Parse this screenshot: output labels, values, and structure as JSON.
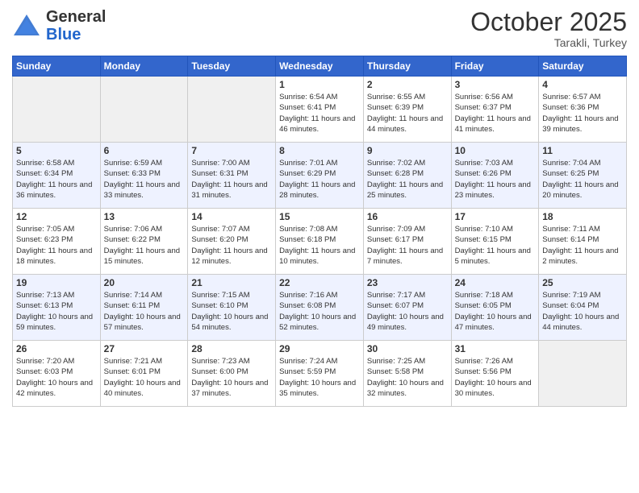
{
  "header": {
    "logo_general": "General",
    "logo_blue": "Blue",
    "month": "October 2025",
    "location": "Tarakli, Turkey"
  },
  "weekdays": [
    "Sunday",
    "Monday",
    "Tuesday",
    "Wednesday",
    "Thursday",
    "Friday",
    "Saturday"
  ],
  "weeks": [
    [
      {
        "day": "",
        "sunrise": "",
        "sunset": "",
        "daylight": ""
      },
      {
        "day": "",
        "sunrise": "",
        "sunset": "",
        "daylight": ""
      },
      {
        "day": "",
        "sunrise": "",
        "sunset": "",
        "daylight": ""
      },
      {
        "day": "1",
        "sunrise": "Sunrise: 6:54 AM",
        "sunset": "Sunset: 6:41 PM",
        "daylight": "Daylight: 11 hours and 46 minutes."
      },
      {
        "day": "2",
        "sunrise": "Sunrise: 6:55 AM",
        "sunset": "Sunset: 6:39 PM",
        "daylight": "Daylight: 11 hours and 44 minutes."
      },
      {
        "day": "3",
        "sunrise": "Sunrise: 6:56 AM",
        "sunset": "Sunset: 6:37 PM",
        "daylight": "Daylight: 11 hours and 41 minutes."
      },
      {
        "day": "4",
        "sunrise": "Sunrise: 6:57 AM",
        "sunset": "Sunset: 6:36 PM",
        "daylight": "Daylight: 11 hours and 39 minutes."
      }
    ],
    [
      {
        "day": "5",
        "sunrise": "Sunrise: 6:58 AM",
        "sunset": "Sunset: 6:34 PM",
        "daylight": "Daylight: 11 hours and 36 minutes."
      },
      {
        "day": "6",
        "sunrise": "Sunrise: 6:59 AM",
        "sunset": "Sunset: 6:33 PM",
        "daylight": "Daylight: 11 hours and 33 minutes."
      },
      {
        "day": "7",
        "sunrise": "Sunrise: 7:00 AM",
        "sunset": "Sunset: 6:31 PM",
        "daylight": "Daylight: 11 hours and 31 minutes."
      },
      {
        "day": "8",
        "sunrise": "Sunrise: 7:01 AM",
        "sunset": "Sunset: 6:29 PM",
        "daylight": "Daylight: 11 hours and 28 minutes."
      },
      {
        "day": "9",
        "sunrise": "Sunrise: 7:02 AM",
        "sunset": "Sunset: 6:28 PM",
        "daylight": "Daylight: 11 hours and 25 minutes."
      },
      {
        "day": "10",
        "sunrise": "Sunrise: 7:03 AM",
        "sunset": "Sunset: 6:26 PM",
        "daylight": "Daylight: 11 hours and 23 minutes."
      },
      {
        "day": "11",
        "sunrise": "Sunrise: 7:04 AM",
        "sunset": "Sunset: 6:25 PM",
        "daylight": "Daylight: 11 hours and 20 minutes."
      }
    ],
    [
      {
        "day": "12",
        "sunrise": "Sunrise: 7:05 AM",
        "sunset": "Sunset: 6:23 PM",
        "daylight": "Daylight: 11 hours and 18 minutes."
      },
      {
        "day": "13",
        "sunrise": "Sunrise: 7:06 AM",
        "sunset": "Sunset: 6:22 PM",
        "daylight": "Daylight: 11 hours and 15 minutes."
      },
      {
        "day": "14",
        "sunrise": "Sunrise: 7:07 AM",
        "sunset": "Sunset: 6:20 PM",
        "daylight": "Daylight: 11 hours and 12 minutes."
      },
      {
        "day": "15",
        "sunrise": "Sunrise: 7:08 AM",
        "sunset": "Sunset: 6:18 PM",
        "daylight": "Daylight: 11 hours and 10 minutes."
      },
      {
        "day": "16",
        "sunrise": "Sunrise: 7:09 AM",
        "sunset": "Sunset: 6:17 PM",
        "daylight": "Daylight: 11 hours and 7 minutes."
      },
      {
        "day": "17",
        "sunrise": "Sunrise: 7:10 AM",
        "sunset": "Sunset: 6:15 PM",
        "daylight": "Daylight: 11 hours and 5 minutes."
      },
      {
        "day": "18",
        "sunrise": "Sunrise: 7:11 AM",
        "sunset": "Sunset: 6:14 PM",
        "daylight": "Daylight: 11 hours and 2 minutes."
      }
    ],
    [
      {
        "day": "19",
        "sunrise": "Sunrise: 7:13 AM",
        "sunset": "Sunset: 6:13 PM",
        "daylight": "Daylight: 10 hours and 59 minutes."
      },
      {
        "day": "20",
        "sunrise": "Sunrise: 7:14 AM",
        "sunset": "Sunset: 6:11 PM",
        "daylight": "Daylight: 10 hours and 57 minutes."
      },
      {
        "day": "21",
        "sunrise": "Sunrise: 7:15 AM",
        "sunset": "Sunset: 6:10 PM",
        "daylight": "Daylight: 10 hours and 54 minutes."
      },
      {
        "day": "22",
        "sunrise": "Sunrise: 7:16 AM",
        "sunset": "Sunset: 6:08 PM",
        "daylight": "Daylight: 10 hours and 52 minutes."
      },
      {
        "day": "23",
        "sunrise": "Sunrise: 7:17 AM",
        "sunset": "Sunset: 6:07 PM",
        "daylight": "Daylight: 10 hours and 49 minutes."
      },
      {
        "day": "24",
        "sunrise": "Sunrise: 7:18 AM",
        "sunset": "Sunset: 6:05 PM",
        "daylight": "Daylight: 10 hours and 47 minutes."
      },
      {
        "day": "25",
        "sunrise": "Sunrise: 7:19 AM",
        "sunset": "Sunset: 6:04 PM",
        "daylight": "Daylight: 10 hours and 44 minutes."
      }
    ],
    [
      {
        "day": "26",
        "sunrise": "Sunrise: 7:20 AM",
        "sunset": "Sunset: 6:03 PM",
        "daylight": "Daylight: 10 hours and 42 minutes."
      },
      {
        "day": "27",
        "sunrise": "Sunrise: 7:21 AM",
        "sunset": "Sunset: 6:01 PM",
        "daylight": "Daylight: 10 hours and 40 minutes."
      },
      {
        "day": "28",
        "sunrise": "Sunrise: 7:23 AM",
        "sunset": "Sunset: 6:00 PM",
        "daylight": "Daylight: 10 hours and 37 minutes."
      },
      {
        "day": "29",
        "sunrise": "Sunrise: 7:24 AM",
        "sunset": "Sunset: 5:59 PM",
        "daylight": "Daylight: 10 hours and 35 minutes."
      },
      {
        "day": "30",
        "sunrise": "Sunrise: 7:25 AM",
        "sunset": "Sunset: 5:58 PM",
        "daylight": "Daylight: 10 hours and 32 minutes."
      },
      {
        "day": "31",
        "sunrise": "Sunrise: 7:26 AM",
        "sunset": "Sunset: 5:56 PM",
        "daylight": "Daylight: 10 hours and 30 minutes."
      },
      {
        "day": "",
        "sunrise": "",
        "sunset": "",
        "daylight": ""
      }
    ]
  ]
}
